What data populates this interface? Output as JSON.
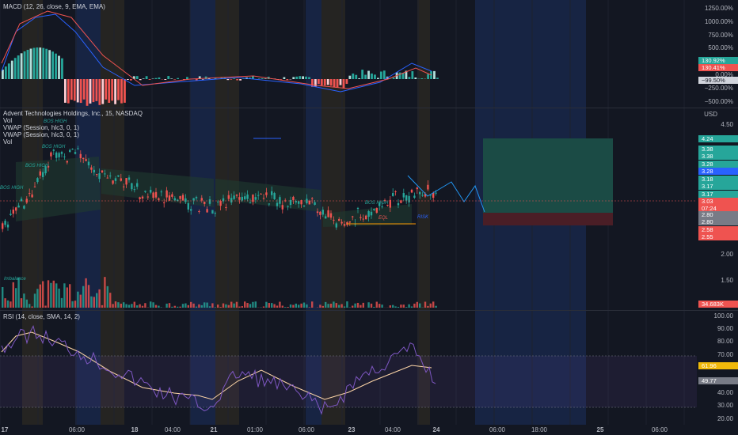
{
  "panes": {
    "macd": {
      "label": "MACD (12, 26, close, 9, EMA, EMA)"
    },
    "main": {
      "title": "Advent Technologies Holdings, Inc., 15, NASDAQ",
      "vol_label": "Vol",
      "vwap1": "VWAP (Session, hlc3, 0, 1)",
      "vwap2": "VWAP (Session, hlc3, 0, 1)",
      "vol_label2": "Vol",
      "currency": "USD"
    },
    "rsi": {
      "label": "RSI (14, close, SMA, 14, 2)"
    }
  },
  "axes": {
    "macd_ticks": [
      "1250.00%",
      "1000.00%",
      "750.00%",
      "500.00%",
      "250.00%",
      "0.00%",
      "−250.00%",
      "−500.00%"
    ],
    "price_ticks": [
      "4.50",
      "3.50",
      "3.00",
      "2.50",
      "2.00",
      "1.50"
    ],
    "rsi_ticks": [
      "100.00",
      "90.00",
      "80.00",
      "70.00",
      "60.00",
      "50.00",
      "40.00",
      "30.00",
      "20.00"
    ],
    "x_ticks": [
      "17",
      "06:00",
      "18",
      "04:00",
      "21",
      "01:00",
      "06:00",
      "23",
      "04:00",
      "24",
      "06:00",
      "18:00",
      "25",
      "06:00"
    ]
  },
  "price_tags": {
    "macd": [
      {
        "text": "130.92%",
        "color": "#26a69a"
      },
      {
        "text": "130.41%",
        "color": "#ef5350"
      },
      {
        "text": "−99.50%",
        "color": "#d1d4dc"
      }
    ],
    "main": [
      {
        "text": "4.24",
        "color": "#26a69a"
      },
      {
        "text": "3.38",
        "color": "#26a69a"
      },
      {
        "text": "3.38",
        "color": "#26a69a"
      },
      {
        "text": "3.28",
        "color": "#26a69a"
      },
      {
        "text": "3.28",
        "color": "#2962ff"
      },
      {
        "text": "3.18",
        "color": "#26a69a"
      },
      {
        "text": "3.17",
        "color": "#26a69a"
      },
      {
        "text": "3.17",
        "color": "#26a69a"
      },
      {
        "text": "3.03",
        "color": "#ef5350"
      },
      {
        "text": "07:24",
        "color": "#ef5350"
      },
      {
        "text": "2.80",
        "color": "#787b86"
      },
      {
        "text": "2.80",
        "color": "#787b86"
      },
      {
        "text": "2.58",
        "color": "#ef5350"
      },
      {
        "text": "2.55",
        "color": "#ef5350"
      }
    ],
    "volume": {
      "text": "34.683K",
      "color": "#ef5350"
    },
    "rsi": [
      {
        "text": "61.96",
        "color": "#f0b90b"
      },
      {
        "text": "49.77",
        "color": "#787b86"
      }
    ]
  },
  "annotations": {
    "bos_high_labels": [
      "BOS HIGH",
      "BOS HIGH",
      "BOS HIGH",
      "BOS HIGH",
      "BOS HIGH"
    ],
    "risk": "RISK",
    "imbalance": "Imbalance",
    "eql": "EQL"
  },
  "colors": {
    "up": "#26a69a",
    "down": "#ef5350",
    "background": "#131722",
    "grid": "#1e222d",
    "session_blue": "#1a2a4f",
    "session_orange": "#2c2a23",
    "long_profit": "#1b4b45",
    "long_loss": "#4a1e26"
  }
}
